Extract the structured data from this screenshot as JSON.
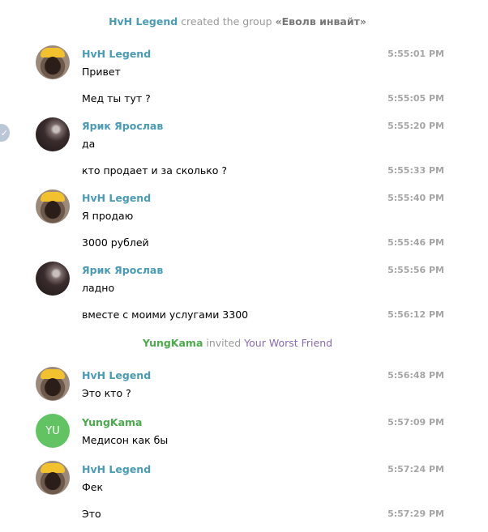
{
  "colors": {
    "hvh": "#4a9bb5",
    "yarik": "#4a9bb5",
    "yungkama": "#4caa4c",
    "invited_target": "#8a6ab5",
    "time": "#a6a6a6",
    "service": "#999999"
  },
  "service": {
    "created": {
      "actor": "HvH Legend",
      "text": "created the group",
      "group": "«Еволв инвайт»"
    },
    "invited": {
      "actor": "YungKama",
      "text": "invited",
      "target": "Your Worst Friend"
    }
  },
  "avatar_initials": {
    "yungkama": "YU"
  },
  "messages": [
    {
      "sender": "HvH Legend",
      "text": "Привет",
      "time": "5:55:01 PM"
    },
    {
      "text": "Мед ты тут ?",
      "time": "5:55:05 PM"
    },
    {
      "sender": "Ярик Ярослав",
      "text": "да",
      "time": "5:55:20 PM"
    },
    {
      "text": "кто продает и за сколько ?",
      "time": "5:55:33 PM"
    },
    {
      "sender": "HvH Legend",
      "text": "Я продаю",
      "time": "5:55:40 PM"
    },
    {
      "text": "3000 рублей",
      "time": "5:55:46 PM"
    },
    {
      "sender": "Ярик Ярослав",
      "text": "ладно",
      "time": "5:55:56 PM"
    },
    {
      "text": "вместе с моими услугами 3300",
      "time": "5:56:12 PM"
    },
    {
      "sender": "HvH Legend",
      "text": "Это кто ?",
      "time": "5:56:48 PM"
    },
    {
      "sender": "YungKama",
      "text": "Медисон как бы",
      "time": "5:57:09 PM"
    },
    {
      "sender": "HvH Legend",
      "text": "Фек",
      "time": "5:57:24 PM"
    },
    {
      "text": "Это",
      "time": "5:57:29 PM"
    }
  ],
  "icons": {
    "side_check": "check-icon"
  }
}
